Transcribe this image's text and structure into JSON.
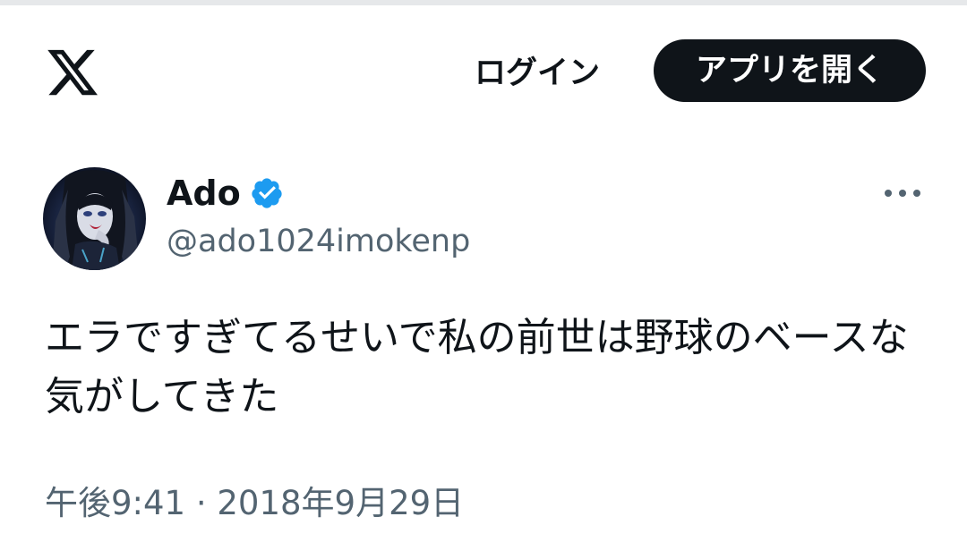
{
  "header": {
    "logo_icon": "x-logo-icon",
    "login_label": "ログイン",
    "open_app_label": "アプリを開く"
  },
  "tweet": {
    "display_name": "Ado",
    "verified_icon": "verified-badge-icon",
    "verified_color": "#1d9bf0",
    "handle": "@ado1024imokenp",
    "more_icon": "more-options-icon",
    "text": "エラですぎてるせいで私の前世は野球のベースな気がしてきた",
    "time": "午後9:41",
    "separator": "·",
    "date": "2018年9月29日"
  },
  "colors": {
    "text": "#0f1419",
    "secondary": "#536471",
    "button_bg": "#0f1419"
  }
}
